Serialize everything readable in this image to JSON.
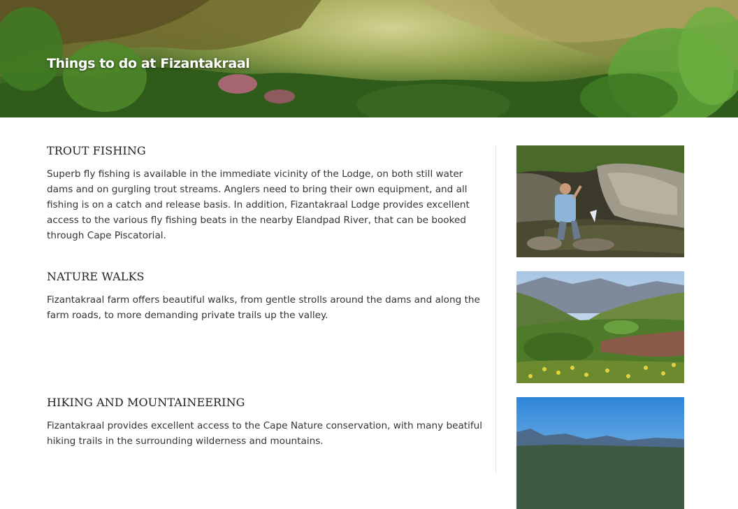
{
  "hero": {
    "title": "Things to do at Fizantakraal"
  },
  "sections": [
    {
      "heading": "TROUT FISHING",
      "body": "Superb fly fishing is available in the immediate vicinity of the Lodge, on both still water dams and on gurgling trout streams. Anglers need to bring their own equipment, and all fishing is on a catch and release basis. In addition, Fizantakraal Lodge provides excellent access to the various fly fishing beats in the nearby Elandpad River, that can be booked through Cape Piscatorial."
    },
    {
      "heading": "NATURE WALKS",
      "body": "Fizantakraal farm offers beautiful walks, from gentle strolls around the dams and along the farm roads, to more demanding private trails up the valley."
    },
    {
      "heading": "HIKING AND MOUNTAINEERING",
      "body": "Fizantakraal provides excellent access to the Cape Nature conservation, with many beatiful hiking trails in the surrounding wilderness and mountains."
    }
  ],
  "photos": [
    "fly-fishing-photo",
    "valley-walk-photo",
    "mountain-hiking-photo"
  ],
  "colors": {
    "heading": "#222222",
    "body_text": "#333333",
    "divider": "#e6e6e6"
  }
}
